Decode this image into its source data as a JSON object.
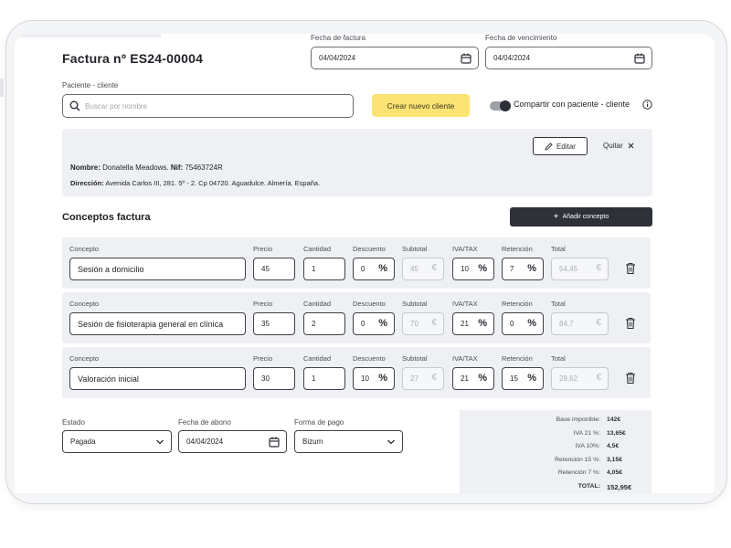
{
  "invoice": {
    "title": "Factura nº ES24-00004",
    "fecha_factura_label": "Fecha de factura",
    "fecha_factura": "04/04/2024",
    "fecha_vencimiento_label": "Fecha de vencimiento",
    "fecha_vencimiento": "04/04/2024"
  },
  "client": {
    "label": "Paciente - cliente",
    "search_placeholder": "Buscar por nombre",
    "create_button": "Crear nuevo cliente",
    "share_label": "Compartir con paciente - cliente",
    "share_enabled": true,
    "edit_button": "Editar",
    "remove_button": "Quitar",
    "nombre_key": "Nombre:",
    "nombre_value": "Donatella Meadows.",
    "nif_key": "Nif:",
    "nif_value": "75463724R",
    "direccion_key": "Dirección:",
    "direccion_value": "Avenida Carlos III, 281. 5º - 2. Cp 04720. Aguadulce. Almería. España."
  },
  "concepts": {
    "title": "Conceptos factura",
    "add_button": "Añadir concepto",
    "headers": {
      "concepto": "Concepto",
      "precio": "Precio",
      "cantidad": "Cantidad",
      "descuento": "Descuento",
      "subtotal": "Subtotal",
      "iva": "IVA/TAX",
      "retencion": "Retención",
      "total": "Total"
    },
    "rows": [
      {
        "concepto": "Sesión a domicilio",
        "precio": "45",
        "cantidad": "1",
        "descuento": "0",
        "subtotal": "45",
        "iva": "10",
        "retencion": "7",
        "total": "54,45"
      },
      {
        "concepto": "Sesión de fisioterapia general en clínica",
        "precio": "35",
        "cantidad": "2",
        "descuento": "0",
        "subtotal": "70",
        "iva": "21",
        "retencion": "0",
        "total": "84,7"
      },
      {
        "concepto": "Valoración inicial",
        "precio": "30",
        "cantidad": "1",
        "descuento": "10",
        "subtotal": "27",
        "iva": "21",
        "retencion": "15",
        "total": "28,62"
      }
    ],
    "percent_symbol": "%",
    "euro_symbol": "€"
  },
  "payment": {
    "estado_label": "Estado",
    "estado_value": "Pagada",
    "fecha_abono_label": "Fecha de abono",
    "fecha_abono_value": "04/04/2024",
    "forma_pago_label": "Forma de pago",
    "forma_pago_value": "Bizum"
  },
  "summary": [
    {
      "label": "Base imponible:",
      "value": "142€"
    },
    {
      "label": "IVA 21 %:",
      "value": "13,65€"
    },
    {
      "label": "IVA 10%:",
      "value": "4,5€"
    },
    {
      "label": "Retención 15 %:",
      "value": "3,15€"
    },
    {
      "label": "Retención 7 %:",
      "value": "4,05€"
    },
    {
      "label": "TOTAL:",
      "value": "152,95€"
    }
  ],
  "colors": {
    "accent_yellow": "#fbe473",
    "dark_button": "#2e3138",
    "panel": "#eef0f3"
  }
}
